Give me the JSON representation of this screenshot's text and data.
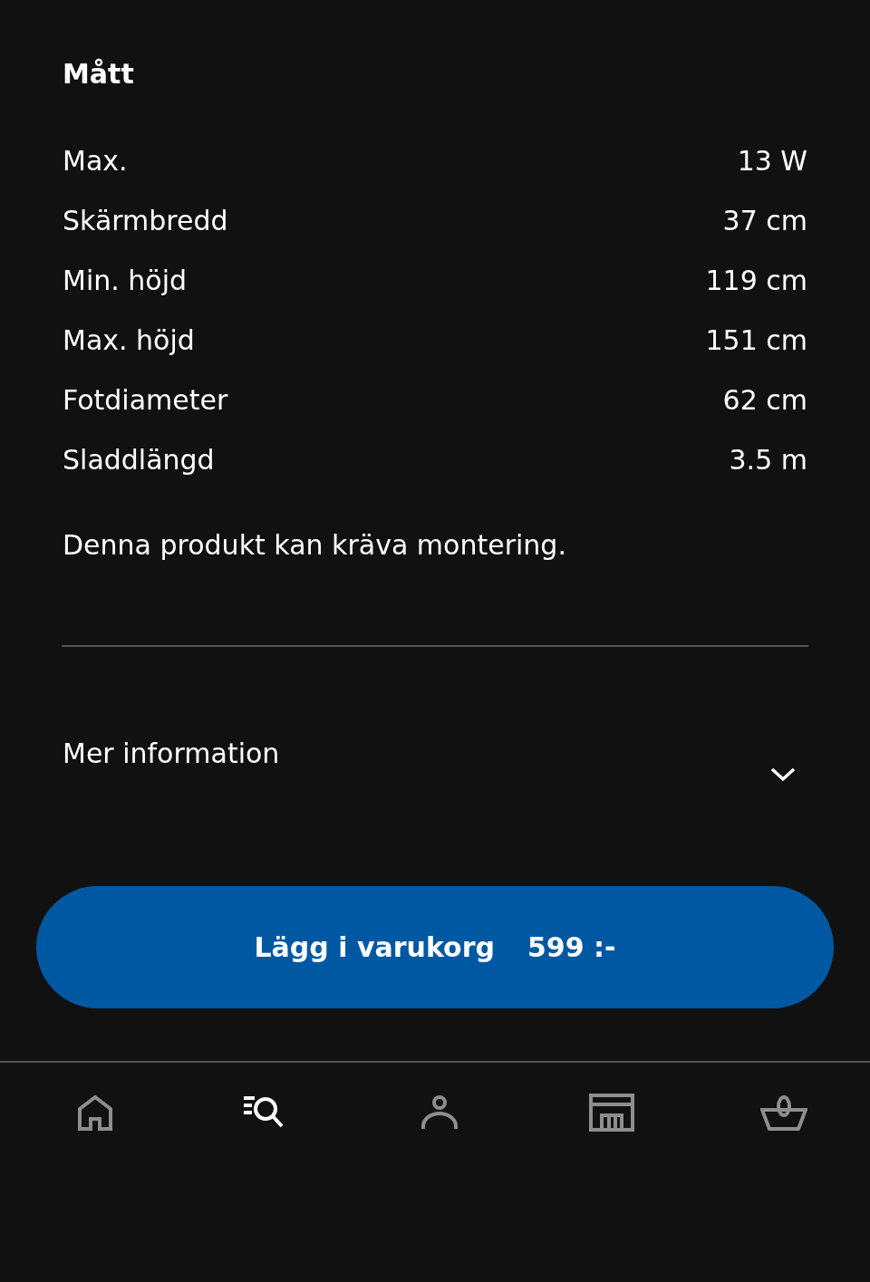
{
  "section": {
    "title": "Mått"
  },
  "specs": [
    {
      "label": "Max.",
      "value": "13 W"
    },
    {
      "label": "Skärmbredd",
      "value": "37 cm"
    },
    {
      "label": "Min. höjd",
      "value": "119 cm"
    },
    {
      "label": "Max. höjd",
      "value": "151 cm"
    },
    {
      "label": "Fotdiameter",
      "value": "62 cm"
    },
    {
      "label": "Sladdlängd",
      "value": "3.5 m"
    }
  ],
  "note": "Denna produkt kan kräva montering.",
  "more_info": {
    "label": "Mer information",
    "expanded": false
  },
  "cart_button": {
    "label": "Lägg i varukorg",
    "price": "599 :-"
  },
  "nav": [
    {
      "kind": "home",
      "selected": false
    },
    {
      "kind": "search",
      "selected": true
    },
    {
      "kind": "profile",
      "selected": false
    },
    {
      "kind": "store",
      "selected": false
    },
    {
      "kind": "basket",
      "selected": false
    }
  ]
}
